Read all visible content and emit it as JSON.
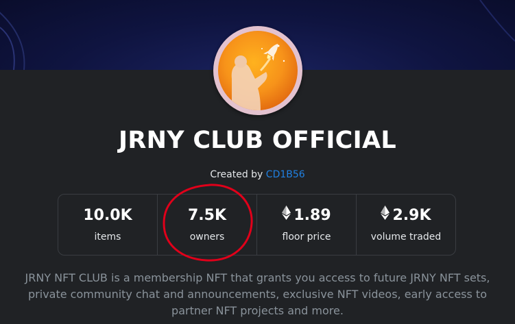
{
  "collection": {
    "name": "JRNY CLUB OFFICIAL",
    "created_by_prefix": "Created by",
    "creator": "CD1B56",
    "description": "JRNY NFT CLUB is a membership NFT that grants you access to future JRNY NFT sets, private community chat and announcements, exclusive NFT videos, early access to partner NFT projects and more."
  },
  "stats": [
    {
      "value": "10.0K",
      "label": "items",
      "icon": ""
    },
    {
      "value": "7.5K",
      "label": "owners",
      "icon": ""
    },
    {
      "value": "1.89",
      "label": "floor price",
      "icon": "ethereum-icon"
    },
    {
      "value": "2.9K",
      "label": "volume traded",
      "icon": "ethereum-icon"
    }
  ],
  "colors": {
    "background": "#202225",
    "banner": "#0f1440",
    "link": "#2081e2",
    "annotation_circle": "#e0001a",
    "muted_text": "#8a939b"
  }
}
